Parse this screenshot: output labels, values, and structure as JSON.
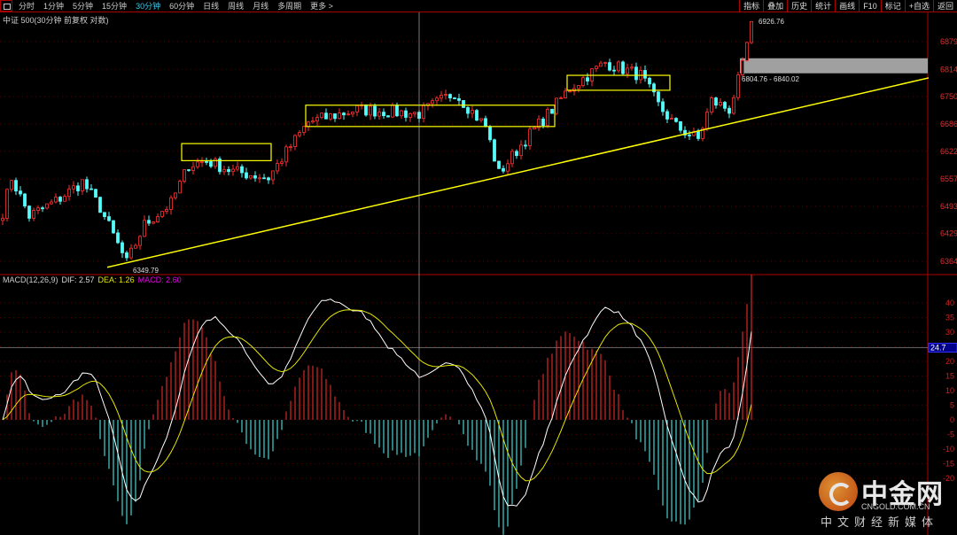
{
  "toolbar": {
    "tabs": [
      "分时",
      "1分钟",
      "5分钟",
      "15分钟",
      "30分钟",
      "60分钟",
      "日线",
      "周线",
      "月线",
      "多周期",
      "更多 >"
    ],
    "active": "30分钟",
    "right": [
      "指标",
      "叠加",
      "历史",
      "统计",
      "画线",
      "F10",
      "标记",
      "+自选",
      "返回"
    ]
  },
  "title": "中证 500(30分钟 前复权 对数)",
  "macd_legend": {
    "name": "MACD(12,26,9)",
    "dif": "DIF: 2.57",
    "dea": "DEA: 1.26",
    "macd": "MACD: 2.60"
  },
  "annotations": {
    "high": "6926.76",
    "low": "6349.79",
    "zone": "6804.76 - 6840.02",
    "crosshair_value": "24.7"
  },
  "watermark": {
    "brand": "中金网",
    "url": "CNGOLD.COM.CN",
    "slogan": "中文财经新媒体"
  },
  "colors": {
    "up": "#ff3030",
    "down": "#54fcfc",
    "dif": "#ffffff",
    "dea": "#e6e600",
    "axis": "#b00000",
    "box": "#ffff00",
    "zone": "#a0a0a0"
  },
  "chart_data": {
    "type": "candlestick",
    "price_axis": {
      "ticks": [
        6879,
        6814,
        6750,
        6686,
        6622,
        6557,
        6493,
        6429,
        6364
      ]
    },
    "macd_axis": {
      "ticks": [
        40,
        35,
        30,
        25,
        20,
        15,
        10,
        5,
        0,
        -5,
        -10,
        -15,
        -20
      ]
    },
    "close_waypoints": [
      [
        0,
        6480
      ],
      [
        2,
        6560
      ],
      [
        6,
        6470
      ],
      [
        12,
        6505
      ],
      [
        18,
        6550
      ],
      [
        22,
        6490
      ],
      [
        28,
        6360
      ],
      [
        32,
        6450
      ],
      [
        38,
        6500
      ],
      [
        42,
        6590
      ],
      [
        46,
        6600
      ],
      [
        52,
        6575
      ],
      [
        60,
        6560
      ],
      [
        64,
        6620
      ],
      [
        69,
        6690
      ],
      [
        80,
        6720
      ],
      [
        94,
        6710
      ],
      [
        102,
        6760
      ],
      [
        109,
        6680
      ],
      [
        112,
        6570
      ],
      [
        118,
        6650
      ],
      [
        124,
        6720
      ],
      [
        128,
        6770
      ],
      [
        136,
        6830
      ],
      [
        144,
        6800
      ],
      [
        148,
        6730
      ],
      [
        152,
        6680
      ],
      [
        157,
        6650
      ],
      [
        160,
        6740
      ],
      [
        164,
        6720
      ],
      [
        167,
        6820
      ],
      [
        169,
        6926
      ]
    ],
    "boxes": [
      {
        "from": 41,
        "to": 60,
        "low": 6600,
        "high": 6640
      },
      {
        "from": 69,
        "to": 124,
        "low": 6680,
        "high": 6730
      },
      {
        "from": 128,
        "to": 150,
        "low": 6765,
        "high": 6800
      }
    ],
    "trendline": [
      [
        23.6,
        6350
      ],
      [
        209,
        6794
      ]
    ],
    "zone": [
      6804.76,
      6840.02
    ],
    "crosshair_index": 94
  }
}
